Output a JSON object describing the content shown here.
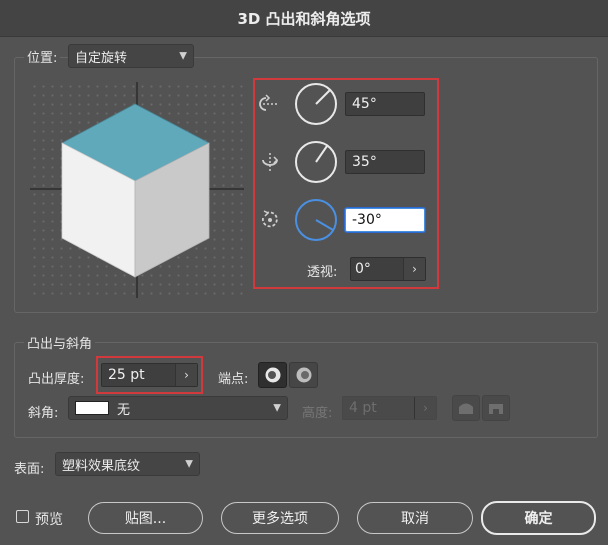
{
  "window": {
    "title": "3D 凸出和斜角选项"
  },
  "position": {
    "label": "位置:",
    "preset": "自定旋转",
    "rotate_x": "45°",
    "rotate_y": "35°",
    "rotate_z": "-30°",
    "perspective_label": "透视:",
    "perspective": "0°"
  },
  "extrude": {
    "section_title": "凸出与斜角",
    "depth_label": "凸出厚度:",
    "depth": "25 pt",
    "cap_label": "端点:",
    "bevel_label": "斜角:",
    "bevel": "无",
    "height_label": "高度:",
    "height": "4 pt"
  },
  "surface": {
    "label": "表面:",
    "value": "塑料效果底纹"
  },
  "footer": {
    "preview_label": "预览",
    "map_button": "贴图...",
    "more_button": "更多选项",
    "cancel_button": "取消",
    "ok_button": "确定"
  },
  "colors": {
    "cube_top": "#5fa9bb",
    "cube_left": "#f1f1f1",
    "cube_right": "#c9c9c9",
    "highlight": "#d2393d",
    "accent": "#4a90e2"
  }
}
